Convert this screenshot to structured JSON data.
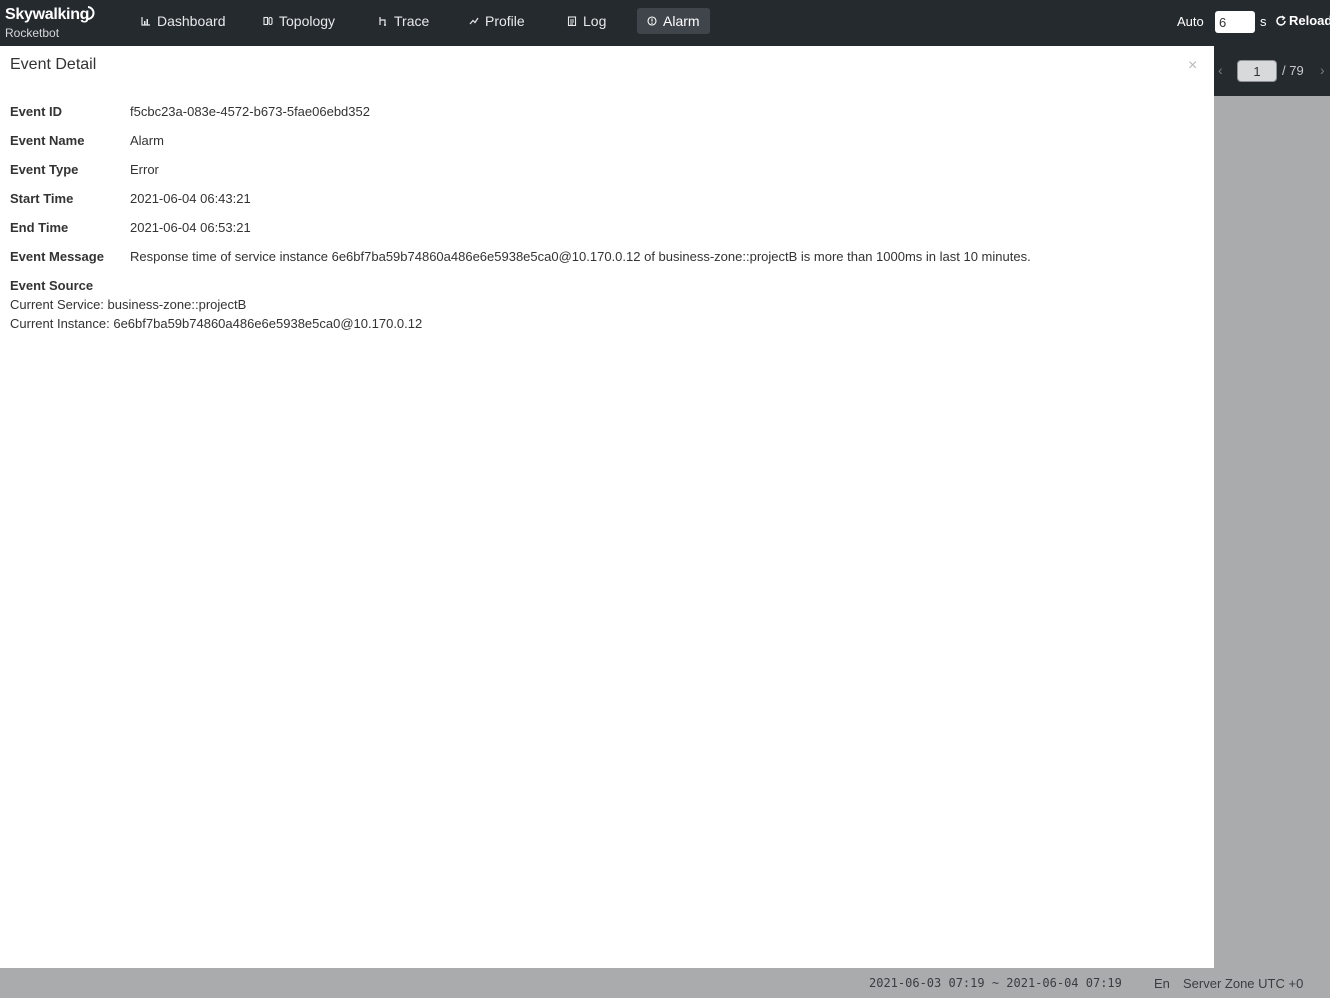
{
  "app": {
    "logo_text": "Skywalking",
    "logo_subtitle": "Rocketbot"
  },
  "nav": {
    "items": [
      {
        "label": "Dashboard",
        "icon": "bar-chart-icon"
      },
      {
        "label": "Topology",
        "icon": "topology-icon"
      },
      {
        "label": "Trace",
        "icon": "trace-icon"
      },
      {
        "label": "Profile",
        "icon": "profile-icon"
      },
      {
        "label": "Log",
        "icon": "log-icon"
      },
      {
        "label": "Alarm",
        "icon": "alarm-icon",
        "active": true
      }
    ]
  },
  "auto_refresh": {
    "label": "Auto",
    "value": "6",
    "unit": "s",
    "reload_label": "Reload"
  },
  "pager": {
    "current": "1",
    "total": "/ 79"
  },
  "modal": {
    "title": "Event Detail",
    "close": "×",
    "fields": [
      {
        "label": "Event ID",
        "value": "f5cbc23a-083e-4572-b673-5fae06ebd352"
      },
      {
        "label": "Event Name",
        "value": "Alarm"
      },
      {
        "label": "Event Type",
        "value": "Error"
      },
      {
        "label": "Start Time",
        "value": "2021-06-04 06:43:21"
      },
      {
        "label": "End Time",
        "value": "2021-06-04 06:53:21"
      },
      {
        "label": "Event Message",
        "value": "Response time of service instance 6e6bf7ba59b74860a486e6e5938e5ca0@10.170.0.12 of business-zone::projectB is more than 1000ms in last 10 minutes."
      }
    ],
    "source": {
      "label": "Event Source",
      "service_label": "Current Service:",
      "service_value": "business-zone::projectB",
      "instance_label": "Current Instance:",
      "instance_value": "6e6bf7ba59b74860a486e6e5938e5ca0@10.170.0.12"
    }
  },
  "footer": {
    "time_range": "2021-06-03 07:19 ~ 2021-06-04 07:19",
    "language": "En",
    "server_zone": "Server Zone UTC +0"
  },
  "colors": {
    "topbar_bg": "#252a2f",
    "active_nav_bg": "#40454b",
    "footer_bg": "#aaabad",
    "modal_bg": "#ffffff"
  }
}
